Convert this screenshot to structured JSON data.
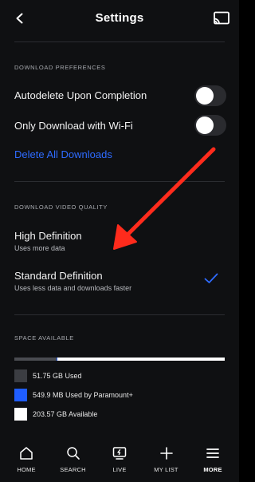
{
  "header": {
    "title": "Settings"
  },
  "download_preferences": {
    "section_label": "DOWNLOAD PREFERENCES",
    "autodelete_label": "Autodelete Upon Completion",
    "autodelete_on": false,
    "wifi_label": "Only Download with Wi-Fi",
    "wifi_on": false,
    "delete_all_label": "Delete All Downloads"
  },
  "video_quality": {
    "section_label": "DOWNLOAD VIDEO QUALITY",
    "options": [
      {
        "title": "High Definition",
        "subtitle": "Uses more data",
        "selected": false
      },
      {
        "title": "Standard Definition",
        "subtitle": "Uses less data and downloads faster",
        "selected": true
      }
    ]
  },
  "space": {
    "section_label": "SPACE AVAILABLE",
    "used_fraction": 0.2,
    "paramount_fraction": 0.002,
    "available_fraction": 0.798,
    "legend": [
      {
        "text": "51.75 GB Used",
        "color": "#3b3d42"
      },
      {
        "text": "549.9 MB Used by Paramount+",
        "color": "#1f5dff"
      },
      {
        "text": "203.57 GB Available",
        "color": "#ffffff"
      }
    ]
  },
  "nav": {
    "items": [
      {
        "label": "HOME",
        "icon": "home-icon"
      },
      {
        "label": "SEARCH",
        "icon": "search-icon"
      },
      {
        "label": "LIVE",
        "icon": "live-tv-icon"
      },
      {
        "label": "MY LIST",
        "icon": "plus-icon"
      },
      {
        "label": "MORE",
        "icon": "menu-icon",
        "active": true
      }
    ]
  },
  "colors": {
    "accent": "#2e6bff",
    "annotation_arrow": "#ff2b1c",
    "background": "#0f1012"
  }
}
